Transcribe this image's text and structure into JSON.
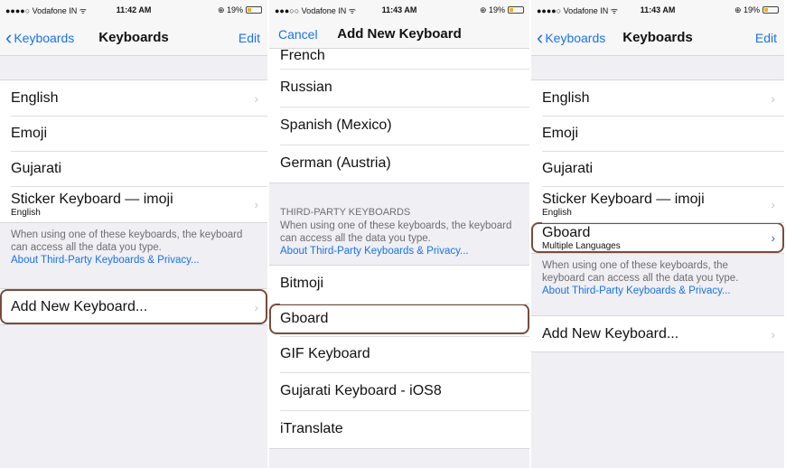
{
  "status": {
    "left": {
      "carrier": "●●●●○ Vodafone IN ᯤ",
      "time": "11:42 AM",
      "battery": "⊕ 19%"
    },
    "middle": {
      "carrier": "●●●○○ Vodafone IN ᯤ",
      "time": "11:43 AM",
      "battery": "⊕ 19%"
    },
    "right": {
      "carrier": "●●●●○ Vodafone IN ᯤ",
      "time": "11:43 AM",
      "battery": "⊕ 19%"
    }
  },
  "panel1": {
    "back_label": "Keyboards",
    "title": "Keyboards",
    "edit_label": "Edit",
    "keyboards": [
      {
        "name": "English",
        "sub": ""
      },
      {
        "name": "Emoji",
        "sub": ""
      },
      {
        "name": "Gujarati",
        "sub": ""
      },
      {
        "name": "Sticker Keyboard — imoji",
        "sub": "English"
      }
    ],
    "note": "When using one of these keyboards, the keyboard can access all the data you type.",
    "link": "About Third-Party Keyboards & Privacy...",
    "add_label": "Add New Keyboard..."
  },
  "panel2": {
    "cancel_label": "Cancel",
    "title": "Add New Keyboard",
    "languages": [
      "French",
      "Russian",
      "Spanish (Mexico)",
      "German (Austria)"
    ],
    "section_header": "THIRD-PARTY KEYBOARDS",
    "note": "When using one of these keyboards, the keyboard can access all the data you type.",
    "link": "About Third-Party Keyboards & Privacy...",
    "third_party": [
      "Bitmoji",
      "Gboard",
      "GIF Keyboard",
      "Gujarati Keyboard - iOS8",
      "iTranslate"
    ]
  },
  "panel3": {
    "back_label": "Keyboards",
    "title": "Keyboards",
    "edit_label": "Edit",
    "keyboards": [
      {
        "name": "English",
        "sub": ""
      },
      {
        "name": "Emoji",
        "sub": ""
      },
      {
        "name": "Gujarati",
        "sub": ""
      },
      {
        "name": "Sticker Keyboard — imoji",
        "sub": "English"
      },
      {
        "name": "Gboard",
        "sub": "Multiple Languages"
      }
    ],
    "note": "When using one of these keyboards, the keyboard can access all the data you type.",
    "link": "About Third-Party Keyboards & Privacy...",
    "add_label": "Add New Keyboard..."
  },
  "icons": {
    "chevron_right": "›",
    "back_chevron": "‹"
  },
  "colors": {
    "accent": "#1a73e8",
    "highlight": "#7a4c3a",
    "battery": "#e8b800"
  }
}
